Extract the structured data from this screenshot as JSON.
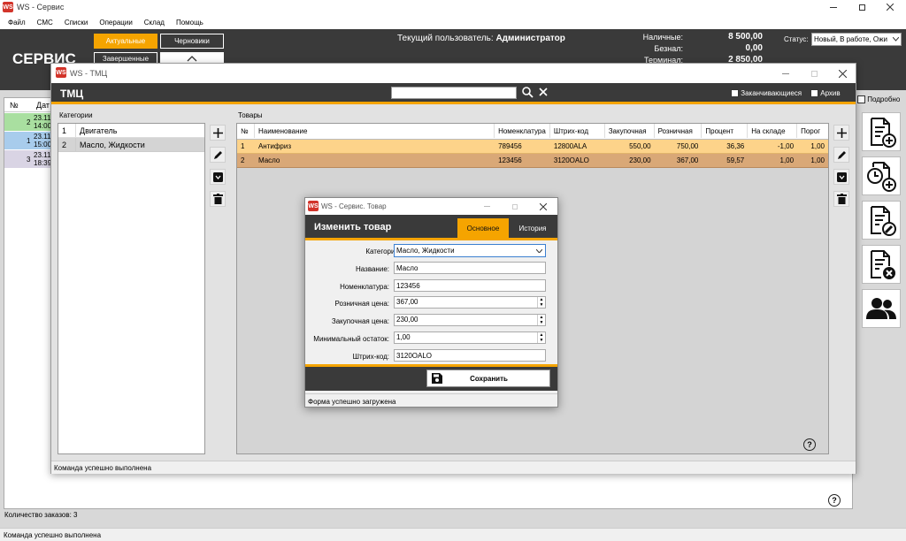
{
  "app": {
    "title": "WS - Сервис",
    "logo": "WS",
    "brand": "СЕРВИС"
  },
  "menu": [
    "Файл",
    "СМС",
    "Списки",
    "Операции",
    "Склад",
    "Помощь"
  ],
  "header": {
    "tab_active": "Актуальные",
    "tab_drafts": "Черновики",
    "tab_completed": "Завершенные",
    "user_label": "Текущий пользователь:",
    "user_name": "Администратор",
    "cash_label": "Наличные:",
    "cash_value": "8 500,00",
    "noncash_label": "Безнал:",
    "noncash_value": "0,00",
    "terminal_label": "Терминал:",
    "terminal_value": "2 850,00",
    "status_label": "Статус:",
    "status_value": "Новый, В работе, Ожи"
  },
  "orders": {
    "col_num": "№",
    "col_date": "Дат",
    "rows": [
      {
        "num": "2",
        "date1": "23.11",
        "date2": "14:00",
        "color": "#a9dfa0"
      },
      {
        "num": "1",
        "date1": "23.11",
        "date2": "15:00",
        "color": "#a8ccec"
      },
      {
        "num": "3",
        "date1": "23.11",
        "date2": "18:39",
        "color": "#d9d4e4"
      }
    ],
    "detailed_label": "Подробно",
    "count_label": "Количество заказов: 3"
  },
  "main_status": "Команда успешно выполнена",
  "tmc": {
    "title": "WS - ТМЦ",
    "header": "ТМЦ",
    "search_value": "",
    "expiring_label": "Заканчивающиеся",
    "archive_label": "Архив",
    "categories_label": "Категории",
    "products_label": "Товары",
    "categories": [
      {
        "num": "1",
        "name": "Двигатель"
      },
      {
        "num": "2",
        "name": "Масло, Жидкости"
      }
    ],
    "columns": [
      "№",
      "Наименование",
      "Номенклатура",
      "Штрих-код",
      "Закупочная",
      "Розничная",
      "Процент",
      "На складе",
      "Порог"
    ],
    "products": [
      [
        "1",
        "Антифриз",
        "789456",
        "12800ALA",
        "550,00",
        "750,00",
        "36,36",
        "-1,00",
        "1,00"
      ],
      [
        "2",
        "Масло",
        "123456",
        "3120OALO",
        "230,00",
        "367,00",
        "59,57",
        "1,00",
        "1,00"
      ]
    ],
    "status": "Команда успешно выполнена"
  },
  "dialog": {
    "title": "WS - Сервис. Товар",
    "header": "Изменить товар",
    "tab_main": "Основное",
    "tab_history": "История",
    "fields": {
      "category": {
        "label": "Категория:",
        "value": "Масло, Жидкости"
      },
      "name": {
        "label": "Название:",
        "value": "Масло"
      },
      "nomenclature": {
        "label": "Номенклатура:",
        "value": "123456"
      },
      "retail": {
        "label": "Розничная цена:",
        "value": "367,00"
      },
      "purchase": {
        "label": "Закупочная цена:",
        "value": "230,00"
      },
      "min_stock": {
        "label": "Минимальный остаток:",
        "value": "1,00"
      },
      "barcode": {
        "label": "Штрих-код:",
        "value": "3120OALO"
      }
    },
    "save_label": "Сохранить",
    "status": "Форма успешно загружена"
  },
  "colors": {
    "accent": "#f5a400",
    "dark": "#3a3a3a",
    "row_hl1": "#fdd38a",
    "row_hl2": "#d9a877"
  },
  "icons": [
    "app-logo-icon",
    "search-icon",
    "clear-icon",
    "plus-icon",
    "pencil-icon",
    "archive-icon",
    "trash-icon",
    "help-icon",
    "save-icon",
    "new-order-icon",
    "scheduled-order-icon",
    "edit-order-icon",
    "delete-order-icon",
    "clients-icon",
    "chevron-up-icon",
    "chevron-down-icon"
  ]
}
